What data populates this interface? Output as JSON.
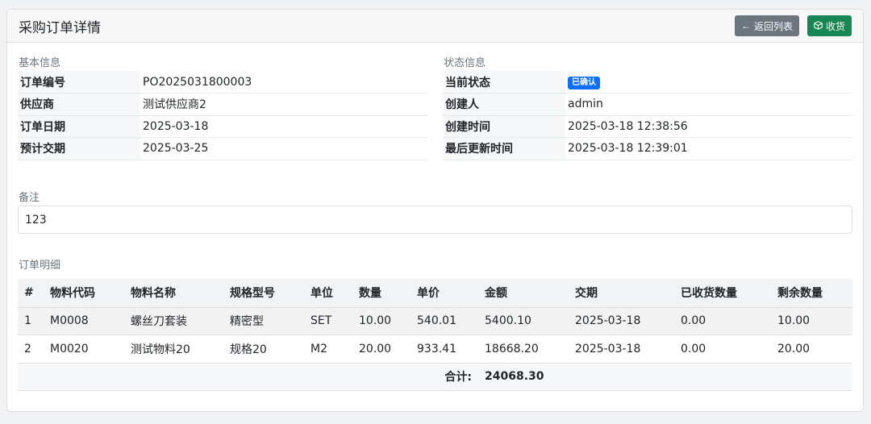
{
  "header": {
    "title": "采购订单详情",
    "back_label": "返回列表",
    "receive_label": "收货"
  },
  "basic": {
    "section_label": "基本信息",
    "rows": [
      {
        "key": "订单编号",
        "value": "PO2025031800003"
      },
      {
        "key": "供应商",
        "value": "测试供应商2"
      },
      {
        "key": "订单日期",
        "value": "2025-03-18"
      },
      {
        "key": "预计交期",
        "value": "2025-03-25"
      }
    ]
  },
  "status": {
    "section_label": "状态信息",
    "rows": [
      {
        "key": "当前状态",
        "value": "已确认"
      },
      {
        "key": "创建人",
        "value": "admin"
      },
      {
        "key": "创建时间",
        "value": "2025-03-18 12:38:56"
      },
      {
        "key": "最后更新时间",
        "value": "2025-03-18 12:39:01"
      }
    ],
    "badge_color": "#0d6efd"
  },
  "remark": {
    "label": "备注",
    "value": "123"
  },
  "items": {
    "section_label": "订单明细",
    "columns": [
      "#",
      "物料代码",
      "物料名称",
      "规格型号",
      "单位",
      "数量",
      "单价",
      "金额",
      "交期",
      "已收货数量",
      "剩余数量"
    ],
    "rows": [
      [
        "1",
        "M0008",
        "螺丝刀套装",
        "精密型",
        "SET",
        "10.00",
        "540.01",
        "5400.10",
        "2025-03-18",
        "0.00",
        "10.00"
      ],
      [
        "2",
        "M0020",
        "测试物料20",
        "规格20",
        "M2",
        "20.00",
        "933.41",
        "18668.20",
        "2025-03-18",
        "0.00",
        "20.00"
      ]
    ],
    "total_label": "合计:",
    "total_value": "24068.30"
  },
  "colors": {
    "secondary_button": "#6c757d",
    "success_button": "#198754"
  }
}
